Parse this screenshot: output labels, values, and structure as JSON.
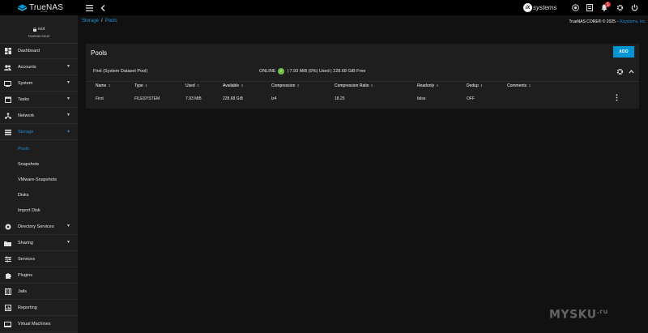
{
  "app": {
    "logo_text": "TrueNAS",
    "logo_sub": "CORE",
    "brand": "systems",
    "notifications_count": "1"
  },
  "user": {
    "name": "root",
    "host": "truenas.local"
  },
  "sidebar": {
    "items": [
      {
        "label": "Dashboard",
        "icon": "dashboard-icon",
        "caret": ""
      },
      {
        "label": "Accounts",
        "icon": "accounts-icon",
        "caret": "▼"
      },
      {
        "label": "System",
        "icon": "system-icon",
        "caret": "▼"
      },
      {
        "label": "Tasks",
        "icon": "tasks-icon",
        "caret": "▼"
      },
      {
        "label": "Network",
        "icon": "network-icon",
        "caret": "▼"
      },
      {
        "label": "Storage",
        "icon": "storage-icon",
        "caret": "▲"
      },
      {
        "label": "Directory Services",
        "icon": "directory-services-icon",
        "caret": "▼"
      },
      {
        "label": "Sharing",
        "icon": "sharing-icon",
        "caret": "▼"
      },
      {
        "label": "Services",
        "icon": "services-icon",
        "caret": ""
      },
      {
        "label": "Plugins",
        "icon": "plugins-icon",
        "caret": ""
      },
      {
        "label": "Jails",
        "icon": "jails-icon",
        "caret": ""
      },
      {
        "label": "Reporting",
        "icon": "reporting-icon",
        "caret": ""
      },
      {
        "label": "Virtual Machines",
        "icon": "virtual-machines-icon",
        "caret": ""
      }
    ],
    "storage_sub": [
      "Pools",
      "Snapshots",
      "VMware-Snapshots",
      "Disks",
      "Import Disk"
    ]
  },
  "breadcrumb": {
    "root": "Storage",
    "sep": "/",
    "current": "Pools"
  },
  "copyright": {
    "text": "TrueNAS CORE® © 2025 - ",
    "link": "iXsystems, Inc."
  },
  "pools": {
    "title": "Pools",
    "add_label": "ADD",
    "pool_name": "First   (System Dataset Pool)",
    "status": "ONLINE",
    "usage": "| 7.93 MiB (0%) Used  |  228.68 GiB Free",
    "columns": [
      "Name",
      "Type",
      "Used",
      "Available",
      "Compression",
      "Compression Ratio",
      "Readonly",
      "Dedup",
      "Comments"
    ],
    "rows": [
      [
        "First",
        "FILESYSTEM",
        "7.93 MiB",
        "228.68 GiB",
        "lz4",
        "18.25",
        "false",
        "OFF",
        ""
      ]
    ]
  },
  "watermark": {
    "text": "MYSKU",
    "sup": ".ru"
  },
  "colors": {
    "accent": "#1e90d6",
    "add_button": "#0095d5",
    "online": "#71bf44"
  }
}
